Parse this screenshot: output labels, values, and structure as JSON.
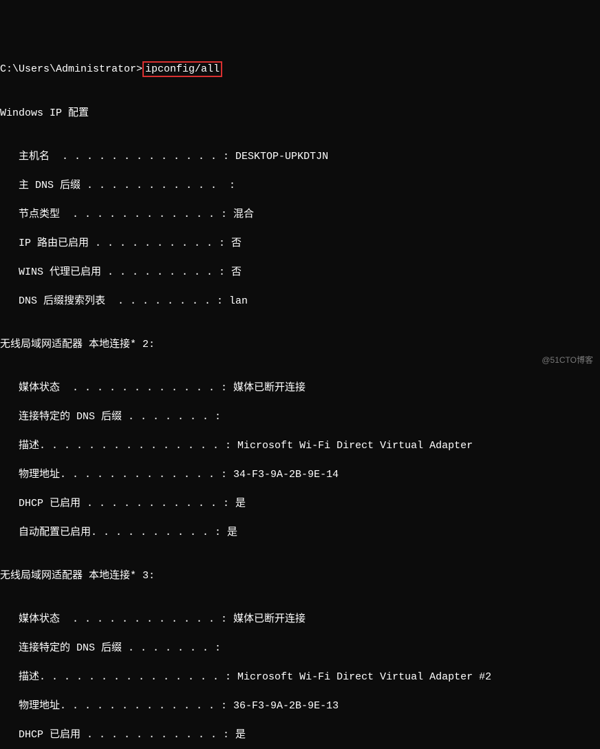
{
  "prompt": "C:\\Users\\Administrator>",
  "command": "ipconfig/all",
  "blank": "",
  "header": "Windows IP 配置",
  "cfg": {
    "l1": "   主机名  . . . . . . . . . . . . . : DESKTOP-UPKDTJN",
    "l2": "   主 DNS 后缀 . . . . . . . . . . .  :",
    "l3": "   节点类型  . . . . . . . . . . . . : 混合",
    "l4": "   IP 路由已启用 . . . . . . . . . . : 否",
    "l5": "   WINS 代理已启用 . . . . . . . . . : 否",
    "l6": "   DNS 后缀搜索列表  . . . . . . . . : lan"
  },
  "adapter2": {
    "title": "无线局域网适配器 本地连接* 2:",
    "l1": "   媒体状态  . . . . . . . . . . . . : 媒体已断开连接",
    "l2": "   连接特定的 DNS 后缀 . . . . . . . :",
    "l3": "   描述. . . . . . . . . . . . . . . : Microsoft Wi-Fi Direct Virtual Adapter",
    "l4": "   物理地址. . . . . . . . . . . . . : 34-F3-9A-2B-9E-14",
    "l5": "   DHCP 已启用 . . . . . . . . . . . : 是",
    "l6": "   自动配置已启用. . . . . . . . . . : 是"
  },
  "adapter3": {
    "title": "无线局域网适配器 本地连接* 3:",
    "l1": "   媒体状态  . . . . . . . . . . . . : 媒体已断开连接",
    "l2": "   连接特定的 DNS 后缀 . . . . . . . :",
    "l3": "   描述. . . . . . . . . . . . . . . : Microsoft Wi-Fi Direct Virtual Adapter #2",
    "l4": "   物理地址. . . . . . . . . . . . . : 36-F3-9A-2B-9E-13",
    "l5": "   DHCP 已启用 . . . . . . . . . . . : 是"
  },
  "watermark": "@51CTO博客"
}
